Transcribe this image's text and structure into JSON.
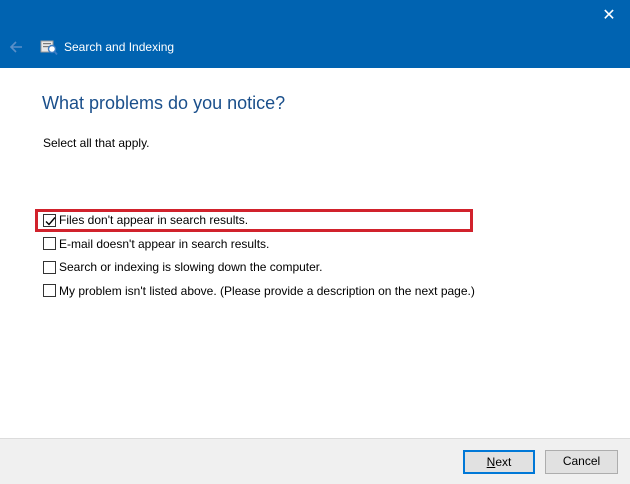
{
  "window": {
    "title": "Search and Indexing",
    "close_symbol": "✕"
  },
  "icons": {
    "back": "back-arrow-icon",
    "app": "search-indexing-icon",
    "close": "close-icon",
    "check": "checkmark-icon"
  },
  "page": {
    "heading": "What problems do you notice?",
    "instruction": "Select all that apply."
  },
  "options": [
    {
      "label": "Files don't appear in search results.",
      "checked": true
    },
    {
      "label": "E-mail doesn't appear in search results.",
      "checked": false
    },
    {
      "label": "Search or indexing is slowing down the computer.",
      "checked": false
    },
    {
      "label": "My problem isn't listed above. (Please provide a description on the next page.)",
      "checked": false
    }
  ],
  "buttons": {
    "next_first": "N",
    "next_rest": "ext",
    "cancel": "Cancel"
  },
  "colors": {
    "titlebar": "#0063b1",
    "heading": "#1a4f8b",
    "highlight": "#d1222c",
    "focus_border": "#0078d7"
  }
}
